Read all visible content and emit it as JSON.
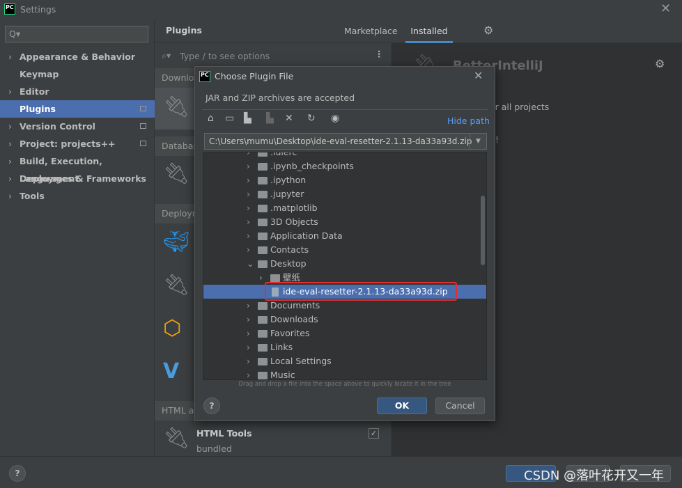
{
  "window": {
    "title": "Settings",
    "logo": "PC"
  },
  "sidebar": {
    "search_placeholder": "Q▾",
    "items": [
      {
        "label": "Appearance & Behavior",
        "expandable": true
      },
      {
        "label": "Keymap",
        "expandable": false
      },
      {
        "label": "Editor",
        "expandable": true
      },
      {
        "label": "Plugins",
        "expandable": false,
        "selected": true
      },
      {
        "label": "Version Control",
        "expandable": true
      },
      {
        "label": "Project: projects++",
        "expandable": true
      },
      {
        "label": "Build, Execution, Deployment",
        "expandable": true
      },
      {
        "label": "Languages & Frameworks",
        "expandable": true
      },
      {
        "label": "Tools",
        "expandable": true
      }
    ]
  },
  "header": {
    "title": "Plugins",
    "tabs": [
      "Marketplace",
      "Installed"
    ],
    "active_tab": "Installed"
  },
  "plugins_list": {
    "search_placeholder": "Type / to see options",
    "sections": [
      "Downlo",
      "Databas",
      "Deploym",
      "HTML a"
    ],
    "html_tools": {
      "name": "HTML Tools",
      "sub": "bundled",
      "checked": true
    }
  },
  "right_panel": {
    "plugin_name": "BetterIntelliJ",
    "text": "or all projects",
    "excl": "!"
  },
  "dialog": {
    "title": "Choose Plugin File",
    "subtitle": "JAR and ZIP archives are accepted",
    "hide_path": "Hide path",
    "path": "C:\\Users\\mumu\\Desktop\\ide-eval-resetter-2.1.13-da33a93d.zip",
    "tree": [
      {
        "label": ".idlerc",
        "level": 1,
        "expanded": false
      },
      {
        "label": ".ipynb_checkpoints",
        "level": 1,
        "expanded": false
      },
      {
        "label": ".ipython",
        "level": 1,
        "expanded": false
      },
      {
        "label": ".jupyter",
        "level": 1,
        "expanded": false
      },
      {
        "label": ".matplotlib",
        "level": 1,
        "expanded": false
      },
      {
        "label": "3D Objects",
        "level": 1,
        "expanded": false
      },
      {
        "label": "Application Data",
        "level": 1,
        "expanded": false
      },
      {
        "label": "Contacts",
        "level": 1,
        "expanded": false
      },
      {
        "label": "Desktop",
        "level": 1,
        "expanded": true
      },
      {
        "label": "壁纸",
        "level": 2,
        "expanded": false
      },
      {
        "label": "ide-eval-resetter-2.1.13-da33a93d.zip",
        "level": 2,
        "file": true,
        "selected": true
      },
      {
        "label": "Documents",
        "level": 1,
        "expanded": false
      },
      {
        "label": "Downloads",
        "level": 1,
        "expanded": false
      },
      {
        "label": "Favorites",
        "level": 1,
        "expanded": false
      },
      {
        "label": "Links",
        "level": 1,
        "expanded": false
      },
      {
        "label": "Local Settings",
        "level": 1,
        "expanded": false
      },
      {
        "label": "Music",
        "level": 1,
        "expanded": false
      }
    ],
    "hint": "Drag and drop a file into the space above to quickly locate it in the tree",
    "ok": "OK",
    "cancel": "Cancel",
    "help": "?"
  },
  "bottom": {
    "help": "?",
    "watermark": "CSDN @落叶花开又一年"
  },
  "colors": {
    "accent": "#4b6eaf",
    "highlight_box": "#e03030",
    "link": "#589df6"
  }
}
